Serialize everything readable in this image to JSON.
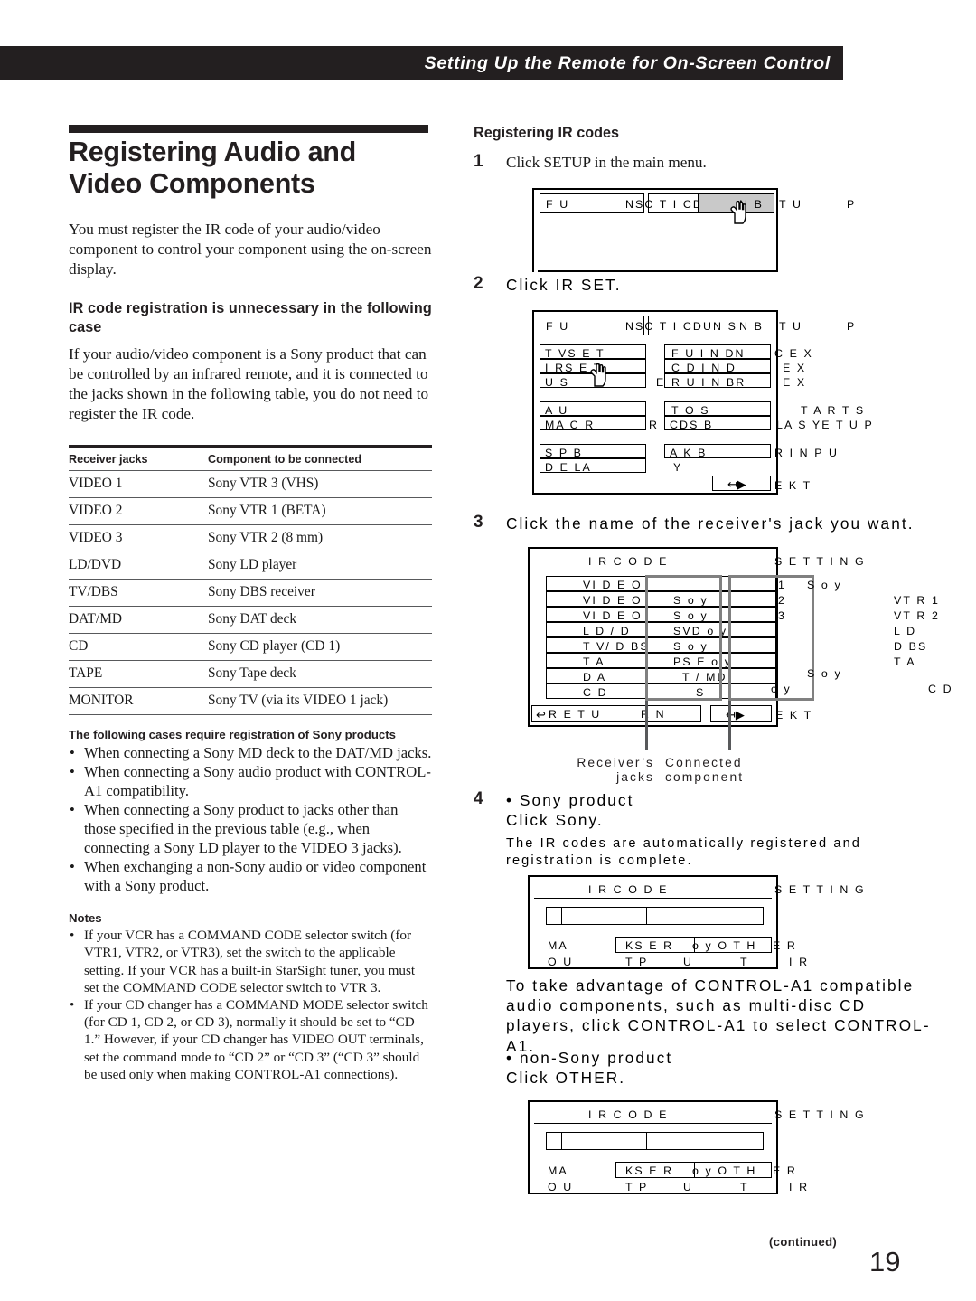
{
  "running_head": "Setting Up the Remote for On-Screen Control",
  "left": {
    "title": "Registering Audio and Video Components",
    "intro": "You must register the IR code of your audio/video component to control your component using the on-screen display.",
    "subhead": "IR code registration is unnecessary in the following case",
    "subhead_body": "If your audio/video component is a Sony product that can be controlled by an infrared remote, and it is connected to the jacks shown in the following table, you do not need to register the IR code.",
    "table": {
      "headers": [
        "Receiver jacks",
        "Component to be connected"
      ],
      "rows": [
        [
          "VIDEO 1",
          "Sony VTR 3 (VHS)"
        ],
        [
          "VIDEO 2",
          "Sony VTR 1 (BETA)"
        ],
        [
          "VIDEO 3",
          "Sony VTR 2 (8 mm)"
        ],
        [
          "LD/DVD",
          "Sony LD player"
        ],
        [
          "TV/DBS",
          "Sony DBS receiver"
        ],
        [
          "DAT/MD",
          "Sony DAT deck"
        ],
        [
          "CD",
          "Sony CD player (CD 1)"
        ],
        [
          "TAPE",
          "Sony Tape deck"
        ],
        [
          "MONITOR",
          "Sony TV (via its VIDEO 1 jack)"
        ]
      ]
    },
    "cases_head": "The following cases require registration of Sony products",
    "cases": [
      "When connecting a Sony MD deck to the DAT/MD jacks.",
      "When connecting a Sony audio product with CONTROL-A1 compatibility.",
      "When connecting a Sony product to jacks other than those specified in the previous table (e.g., when connecting a Sony LD player to the VIDEO 3 jacks).",
      "When exchanging a non-Sony audio or video component with a Sony product."
    ],
    "notes_head": "Notes",
    "notes": [
      "If your VCR has a COMMAND CODE selector switch (for VTR1, VTR2, or VTR3), set the switch to the applicable setting.  If your VCR has a built-in StarSight tuner, you must set the COMMAND CODE selector switch to VTR 3.",
      "If your CD changer has a COMMAND MODE selector switch (for CD 1, CD 2, or CD 3), normally it should be set to “CD 1.”  However, if your CD changer has VIDEO OUT terminals, set the command mode to “CD 2” or “CD 3” (“CD 3” should be used only when making CONTROL-A1 connections)."
    ]
  },
  "right": {
    "subhead": "Registering IR codes",
    "step1": {
      "num": "1",
      "text": "Click SETUP in the main menu.",
      "osd": {
        "menu_left": "F    U",
        "menu_mid": "NSC   T I CDUN S",
        "menu_right": "N B",
        "tail1": "T U",
        "tail2": "P"
      }
    },
    "step2": {
      "num": "2",
      "text": "Click IR SET.",
      "osd": {
        "title_left": "F    U",
        "title_mid": "NSC   T I CDUN S",
        "title_right": "N B",
        "tail1": "T U",
        "tail2": "P",
        "col1": [
          "T VS                E T",
          "I  RS                E T",
          "U                         S"
        ],
        "col2": [
          "F    U     I  N DN",
          "C    D     I  N D",
          "R U      I  N BR"
        ],
        "col3": [
          "A                       U",
          "MA                  C   R"
        ],
        "col4": [
          "T O               S",
          "CDS            B"
        ],
        "col5": [
          "S      P         B",
          "D    E LA"
        ],
        "col6": [
          "A                K    B",
          "Y"
        ],
        "outside": [
          "C E X",
          "E X",
          "E X",
          "T A          R  T         S",
          "LA   S     YE T U          P",
          "R            I N P    U",
          "E K T"
        ],
        "exit_label": "→"
      }
    },
    "step3": {
      "num": "3",
      "text": "Click the name of the receiver's jack you want.",
      "osd": {
        "header": "I  R          C   O D      E",
        "header_tail": "S          E T T I N G",
        "rows": [
          {
            "jack": "VI   D      E O",
            "comp": ""
          },
          {
            "jack": "VI   D      E O",
            "comp": "S            o  y"
          },
          {
            "jack": "VI   D      E O",
            "comp": "S            o  y"
          },
          {
            "jack": "L D      /    D",
            "comp": "SVD      o  y"
          },
          {
            "jack": "T V/   D     BS",
            "comp": "S            o  y"
          },
          {
            "jack": "T A",
            "comp": "PS        E o  y"
          },
          {
            "jack": "D      A",
            "comp": "T /   MD"
          },
          {
            "jack": "C    D",
            "comp": "S"
          }
        ],
        "outside_left": [
          "1",
          "2",
          "3"
        ],
        "outside_mid": [
          "S          o  y",
          "S          o  y",
          "o  y"
        ],
        "outside_right": [
          "VT R    1",
          "VT R    2",
          "L D",
          "D      BS",
          "T A",
          "C   D"
        ],
        "footer_left": "R    E T U",
        "footer_mid": "R   N",
        "footer_tail": "E K T"
      },
      "caption_left": "Receiver’s jacks",
      "caption_right": "Connected component"
    },
    "step4": {
      "num": "4",
      "bullet_sony": "• Sony product",
      "click_sony": "Click Sony.",
      "sony_note": "The IR codes are automatically registered and registration is complete.",
      "osd_sony": {
        "header": "I  R          C   O D      E",
        "header_tail": "S          E T T I N G",
        "row1": "MA",
        "row2": "O U",
        "btn1": "KS      E  R",
        "btn2": "o  y O T H",
        "btn_tail": "E  R",
        "sub1": "T P",
        "sub2": "U",
        "sub3": "T",
        "sub_tail": "I  R"
      },
      "control_a1_note": "To take advantage of CONTROL-A1 compatible audio components, such as multi-disc CD players, click CONTROL-A1 to select CONTROL-A1.",
      "bullet_nonsony": "• non-Sony product",
      "click_other": "Click OTHER.",
      "osd_other": {
        "header": "I  R          C   O D      E",
        "header_tail": "S          E T T I N G",
        "row1": "MA",
        "row2": "O U",
        "btn1": "KS      E  R",
        "btn2": "o  y O T H",
        "btn_tail": "E  R",
        "sub1": "T P",
        "sub2": "U",
        "sub3": "T",
        "sub_tail": "I  R"
      }
    }
  },
  "footer": {
    "continued": "(continued)",
    "page": "19"
  }
}
